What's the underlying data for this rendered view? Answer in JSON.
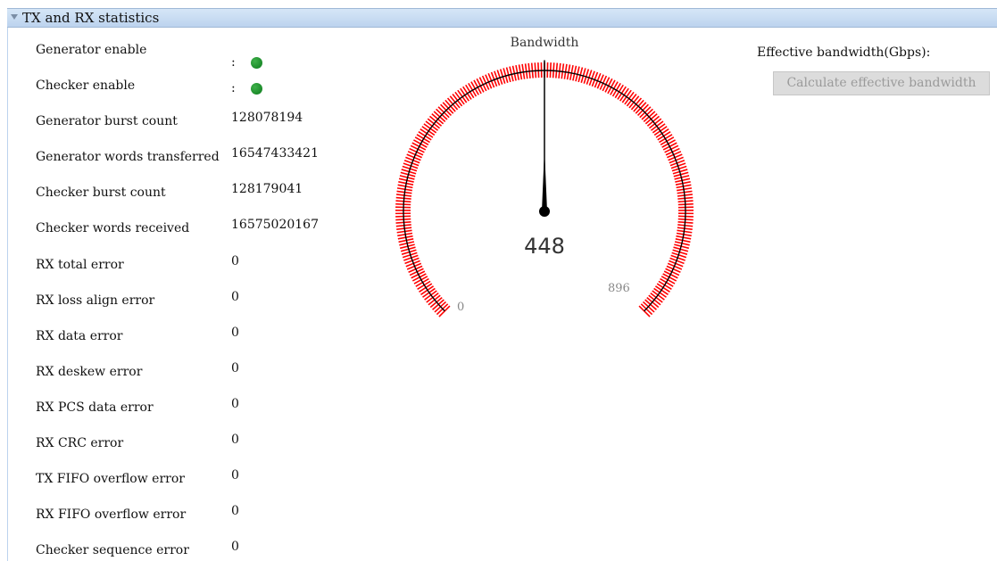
{
  "section": {
    "title": "TX and RX statistics"
  },
  "stats": [
    {
      "label": "Generator enable",
      "value": ":",
      "indicator": "led-on"
    },
    {
      "label": "Checker enable",
      "value": ":",
      "indicator": "led-on"
    },
    {
      "label": "Generator burst count",
      "value": "128078194"
    },
    {
      "label": "Generator words transferred",
      "value": "16547433421"
    },
    {
      "label": "Checker burst count",
      "value": "128179041"
    },
    {
      "label": "Checker words received",
      "value": "16575020167"
    },
    {
      "label": "RX total error",
      "value": "0"
    },
    {
      "label": "RX loss align error",
      "value": "0"
    },
    {
      "label": "RX data error",
      "value": "0"
    },
    {
      "label": "RX deskew error",
      "value": "0"
    },
    {
      "label": "RX PCS data error",
      "value": "0"
    },
    {
      "label": "RX CRC error",
      "value": "0"
    },
    {
      "label": "TX FIFO overflow error",
      "value": "0"
    },
    {
      "label": "RX FIFO overflow error",
      "value": "0"
    },
    {
      "label": "Checker sequence error",
      "value": "0"
    }
  ],
  "gauge": {
    "title": "Bandwidth",
    "value": "448",
    "min_label": "0",
    "max_label": "896",
    "reading": 448,
    "min": 0,
    "max": 896,
    "tick_color": "#ff0000",
    "needle_color": "#000000"
  },
  "effective_bandwidth": {
    "label": "Effective bandwidth(Gbps):",
    "button_label": "Calculate effective bandwidth"
  },
  "colors": {
    "led_on": "#1a8a2a",
    "header_bg": "#c9dcf2"
  }
}
